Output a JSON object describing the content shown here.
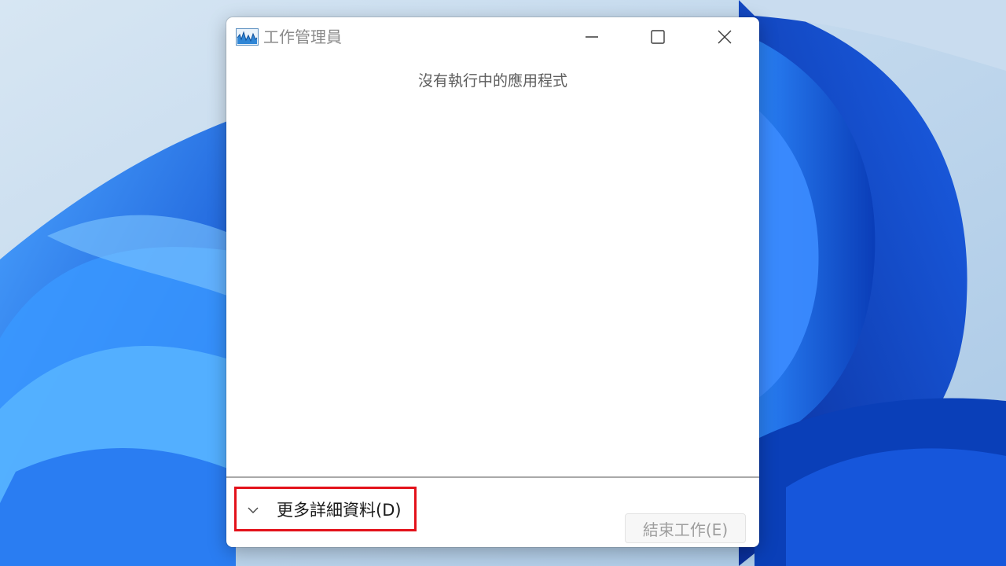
{
  "window": {
    "title": "工作管理員",
    "app_icon": "task-manager-icon"
  },
  "caption_buttons": {
    "minimize_icon": "minimize-icon",
    "maximize_icon": "maximize-icon",
    "close_icon": "close-icon"
  },
  "main": {
    "empty_message": "沒有執行中的應用程式"
  },
  "footer": {
    "more_details_label": "更多詳細資料(D)",
    "more_details_icon": "chevron-down-icon",
    "end_task_label": "結束工作(E)",
    "end_task_enabled": false
  },
  "colors": {
    "highlight_border": "#e3121b",
    "wallpaper_blue": "#1f6ff0"
  }
}
